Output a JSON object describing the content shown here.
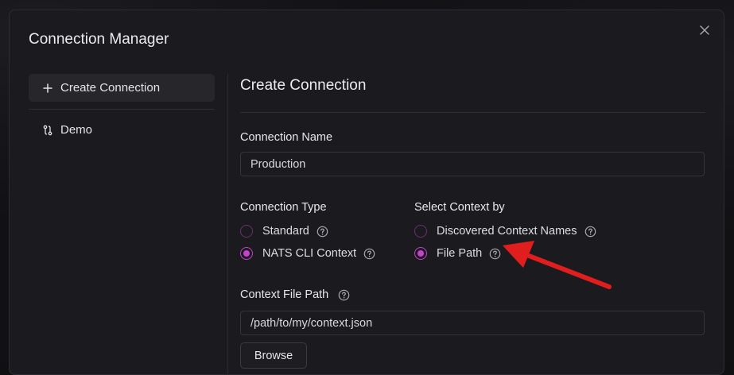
{
  "dialog": {
    "title": "Connection Manager"
  },
  "sidebar": {
    "items": [
      {
        "label": "Create Connection",
        "icon": "plus-icon",
        "active": true
      },
      {
        "label": "Demo",
        "icon": "connection-icon",
        "active": false
      }
    ]
  },
  "main": {
    "title": "Create Connection",
    "connection_name": {
      "label": "Connection Name",
      "value": "Production"
    },
    "connection_type": {
      "label": "Connection Type",
      "options": [
        {
          "label": "Standard",
          "checked": false
        },
        {
          "label": "NATS CLI Context",
          "checked": true
        }
      ]
    },
    "select_context": {
      "label": "Select Context by",
      "options": [
        {
          "label": "Discovered Context Names",
          "checked": false
        },
        {
          "label": "File Path",
          "checked": true
        }
      ]
    },
    "context_file_path": {
      "label": "Context File Path",
      "value": "/path/to/my/context.json"
    },
    "browse_label": "Browse"
  },
  "colors": {
    "accent": "#c93fd1",
    "annotation_arrow": "#e01e1e",
    "background": "#1b1b1f"
  }
}
